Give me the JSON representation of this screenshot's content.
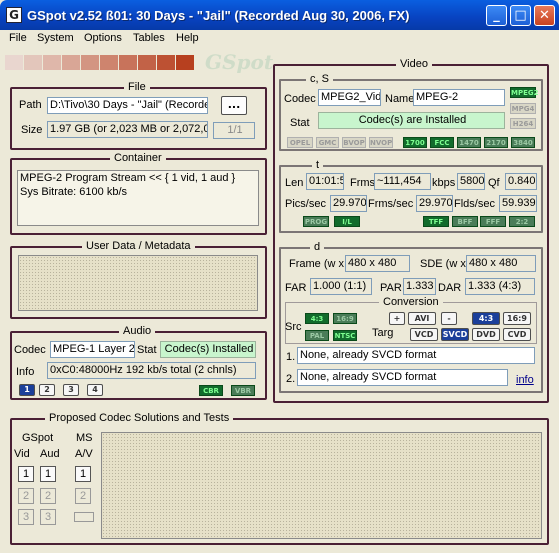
{
  "window": {
    "title": "GSpot v2.52 ß01: 30 Days - \"Jail\" (Recorded Aug 30, 2006, FX)",
    "min": "_",
    "max": "□",
    "close": "✕"
  },
  "menu": [
    "File",
    "System",
    "Options",
    "Tables",
    "Help"
  ],
  "logo": "GSpot",
  "banner_colors": [
    "#e9d6cf",
    "#e3c6bb",
    "#dfb7aa",
    "#d9a696",
    "#d39582",
    "#ce846e",
    "#c8735b",
    "#c26247",
    "#bd5133",
    "#b7401f"
  ],
  "file": {
    "title": "File",
    "path_label": "Path",
    "path_value": "D:\\Tivo\\30 Days - \"Jail\" (Recorde",
    "browse": "...",
    "size_label": "Size",
    "size_value": "1.97 GB (or 2,023 MB or 2,072,07",
    "fraction": "1/1"
  },
  "container": {
    "title": "Container",
    "line1": "MPEG-2 Program Stream << { 1 vid, 1 aud }",
    "line2": "Sys Bitrate: 6100 kb/s"
  },
  "userdata": {
    "title": "User Data / Metadata"
  },
  "audio": {
    "title": "Audio",
    "codec_label": "Codec",
    "codec_value": "MPEG-1 Layer 2",
    "stat_label": "Stat",
    "stat_value": "Codec(s) Installed",
    "info_label": "Info",
    "info_value": "0xC0:48000Hz  192 kb/s total (2 chnls)",
    "streams": [
      "1",
      "2",
      "3",
      "4"
    ],
    "flags": [
      "CBR",
      "VBR"
    ]
  },
  "video": {
    "title": "Video",
    "cs": {
      "title": "c, S",
      "codec_label": "Codec",
      "codec_value": "MPEG2_Vid",
      "name_label": "Name",
      "name_value": "MPEG-2",
      "stat_label": "Stat",
      "stat_value": "Codec(s) are Installed",
      "side_tags": [
        "MPEG2",
        "MPG4",
        "H264"
      ],
      "tags_left": [
        "OPEL",
        "GMC",
        "BVOP",
        "NVOP"
      ],
      "tags_right": [
        "1700",
        "FCC",
        "1470",
        "2170",
        "3840"
      ]
    },
    "t": {
      "title": "t",
      "len_label": "Len",
      "len_value": "01:01:5",
      "frms_label": "Frms",
      "frms_value": "~111,454",
      "kbps_label": "kbps",
      "kbps_value": "5800",
      "qf_label": "Qf",
      "qf_value": "0.840",
      "pics_label": "Pics/sec",
      "pics_value": "29.970",
      "frms_sec_label": "Frms/sec",
      "frms_sec_value": "29.970",
      "flds_label": "Flds/sec",
      "flds_value": "59.939",
      "tags_left": [
        "PROG",
        "I/L"
      ],
      "tags_right": [
        "TFF",
        "BFF",
        "FFF",
        "2:2"
      ]
    },
    "d": {
      "title": "d",
      "frame_label": "Frame (w x",
      "frame_value": "480 x 480",
      "sde_label": "SDE (w x",
      "sde_value": "480 x 480",
      "far_label": "FAR",
      "far_value": "1.000 (1:1)",
      "par_label": "PAR",
      "par_value": "1.333",
      "dar_label": "DAR",
      "dar_value": "1.333 (4:3)",
      "conversion": "Conversion",
      "src_label": "Src",
      "src_ar": [
        "4:3",
        "16:9"
      ],
      "src_std": [
        "PAL",
        "NTSC"
      ],
      "targ_label": "Targ",
      "targ_ar": [
        "+",
        "AVI",
        "-",
        "4:3",
        "16:9"
      ],
      "targ_fmt": [
        "VCD",
        "SVCD",
        "DVD",
        "CVD"
      ],
      "line1_num": "1.",
      "line1": "None, already SVCD format",
      "line2_num": "2.",
      "line2": "None, already SVCD format",
      "info_link": "info"
    }
  },
  "proposed": {
    "title": "Proposed Codec Solutions and Tests",
    "gspot_label": "GSpot",
    "vid_label": "Vid",
    "aud_label": "Aud",
    "ms_label": "MS",
    "av_label": "A/V",
    "nums": [
      "1",
      "2",
      "3"
    ]
  }
}
